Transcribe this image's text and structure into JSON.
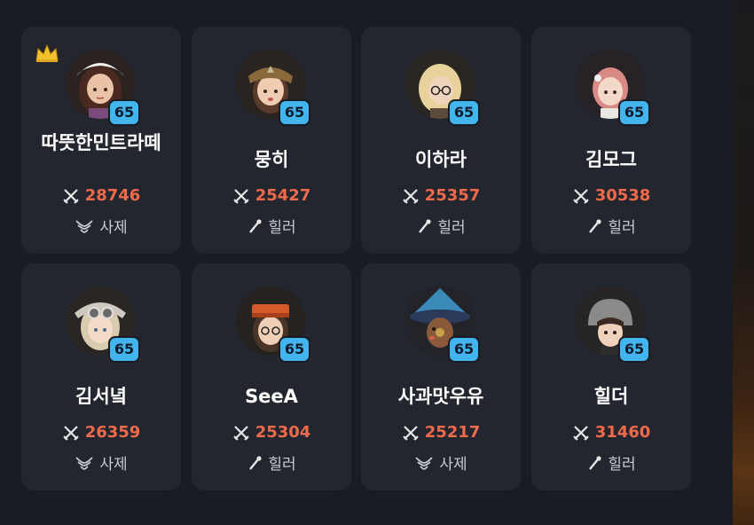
{
  "cards": [
    {
      "name": "따뜻한민트라떼",
      "level": "65",
      "power": "28746",
      "class": "사제",
      "class_icon": "priest-icon",
      "crown": true
    },
    {
      "name": "뭉히",
      "level": "65",
      "power": "25427",
      "class": "힐러",
      "class_icon": "healer-icon",
      "crown": false
    },
    {
      "name": "이하라",
      "level": "65",
      "power": "25357",
      "class": "힐러",
      "class_icon": "healer-icon",
      "crown": false
    },
    {
      "name": "김모그",
      "level": "65",
      "power": "30538",
      "class": "힐러",
      "class_icon": "healer-icon",
      "crown": false
    },
    {
      "name": "김서녘",
      "level": "65",
      "power": "26359",
      "class": "사제",
      "class_icon": "priest-icon",
      "crown": false
    },
    {
      "name": "SeeA",
      "level": "65",
      "power": "25304",
      "class": "힐러",
      "class_icon": "healer-icon",
      "crown": false
    },
    {
      "name": "사과맛우유",
      "level": "65",
      "power": "25217",
      "class": "사제",
      "class_icon": "priest-icon",
      "crown": false
    },
    {
      "name": "힐더",
      "level": "65",
      "power": "31460",
      "class": "힐러",
      "class_icon": "healer-icon",
      "crown": false
    }
  ],
  "icons": {
    "leader": "crown-icon",
    "power": "crossed-swords-icon"
  },
  "colors": {
    "card_bg": "#24262f",
    "page_bg": "#1a1c24",
    "power": "#ef6a4a",
    "level_badge": "#42b4ee",
    "crown": "#f2c12e"
  }
}
